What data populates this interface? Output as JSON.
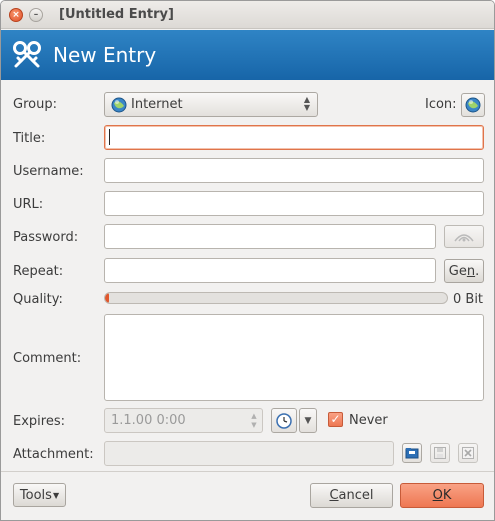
{
  "window": {
    "title": "[Untitled Entry]",
    "close_glyph": "×",
    "minimize_glyph": "–"
  },
  "banner": {
    "title": "New Entry",
    "icon": "keys-icon"
  },
  "form": {
    "group": {
      "label": "Group:",
      "value": "Internet",
      "icon": "globe-icon"
    },
    "icon": {
      "label": "Icon:",
      "icon": "globe-icon"
    },
    "title": {
      "label": "Title:",
      "value": ""
    },
    "username": {
      "label": "Username:",
      "value": ""
    },
    "url": {
      "label": "URL:",
      "value": ""
    },
    "password": {
      "label": "Password:",
      "value": ""
    },
    "repeat": {
      "label": "Repeat:",
      "value": "",
      "gen_button_prefix": "Ge",
      "gen_button_mnemonic": "n",
      "gen_button_suffix": "."
    },
    "quality": {
      "label": "Quality:",
      "text": "0 Bit",
      "fraction": 0.0
    },
    "comment": {
      "label": "Comment:",
      "value": ""
    },
    "expires": {
      "label": "Expires:",
      "value": "1.1.00 0:00",
      "never_label": "Never",
      "never_checked": true
    },
    "attachment": {
      "label": "Attachment:",
      "value": ""
    }
  },
  "footer": {
    "tools_label": "Tools",
    "cancel_mnemonic": "C",
    "cancel_rest": "ancel",
    "ok_mnemonic": "O",
    "ok_rest": "K"
  },
  "colors": {
    "accent": "#ee7752",
    "banner": "#1f70b3"
  }
}
